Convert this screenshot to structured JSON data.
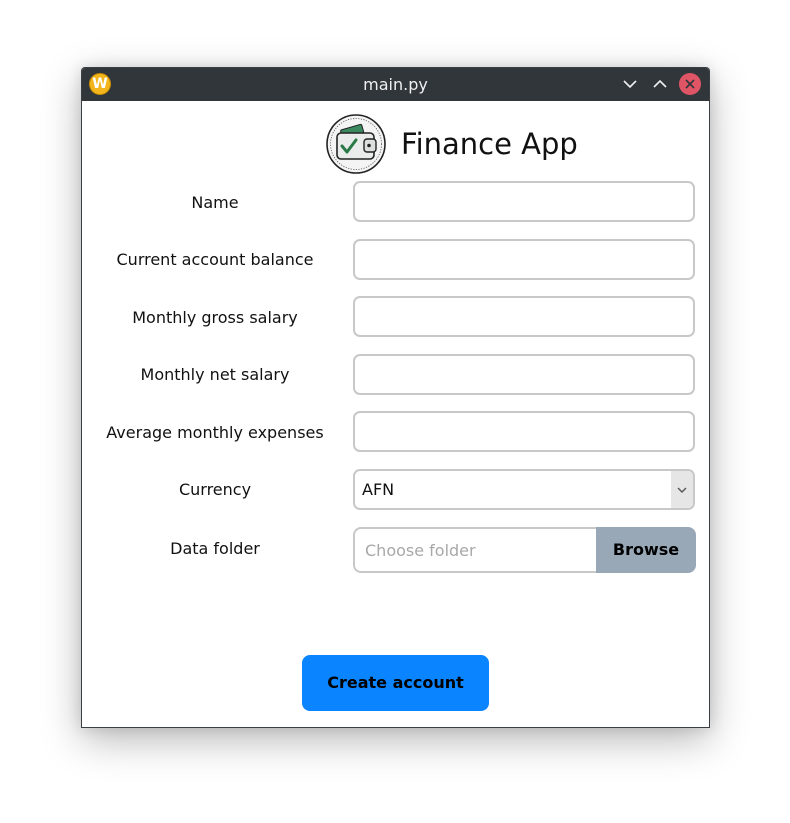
{
  "window": {
    "title": "main.py",
    "app_icon_letter": "W"
  },
  "header": {
    "title": "Finance App"
  },
  "form": {
    "fields": [
      {
        "label": "Name",
        "value": "",
        "placeholder": ""
      },
      {
        "label": "Current account balance",
        "value": "",
        "placeholder": ""
      },
      {
        "label": "Monthly gross salary",
        "value": "",
        "placeholder": ""
      },
      {
        "label": "Monthly net salary",
        "value": "",
        "placeholder": ""
      },
      {
        "label": "Average monthly expenses",
        "value": "",
        "placeholder": ""
      }
    ],
    "currency": {
      "label": "Currency",
      "selected": "AFN"
    },
    "data_folder": {
      "label": "Data folder",
      "placeholder": "Choose folder",
      "value": "",
      "browse_label": "Browse"
    },
    "create_label": "Create account"
  },
  "colors": {
    "titlebar": "#31363b",
    "close_button": "#e05565",
    "primary_button": "#0a84ff",
    "browse_button": "#98a8b7",
    "input_border": "#c8c8c8"
  },
  "icons": {
    "app": "app-logo-icon",
    "minimize": "chevron-down-icon",
    "maximize": "chevron-up-icon",
    "close": "close-icon",
    "logo": "wallet-check-icon",
    "dropdown": "chevron-down-icon"
  }
}
